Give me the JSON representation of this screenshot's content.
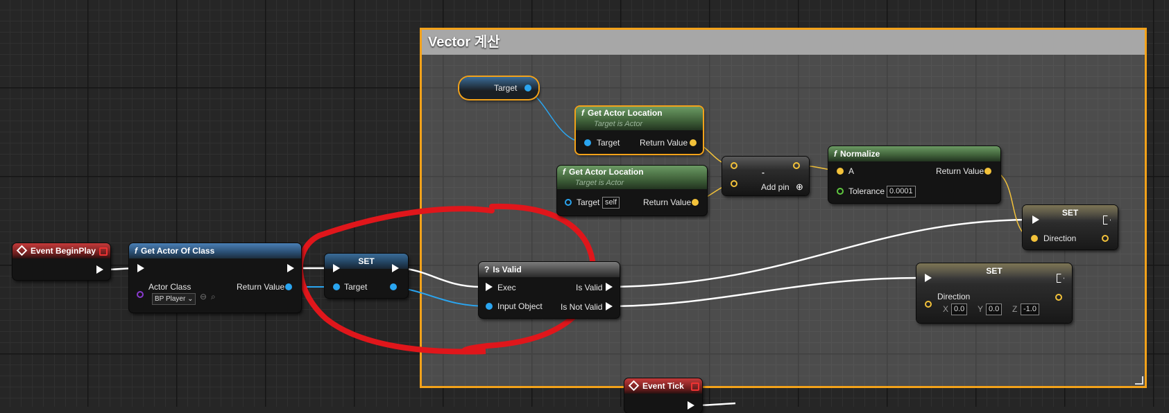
{
  "comment": {
    "title": "Vector 계산"
  },
  "event_begin_play": {
    "title": "Event BeginPlay"
  },
  "get_actor_of_class": {
    "title": "Get Actor Of Class",
    "actor_class_label": "Actor Class",
    "actor_class_value": "BP Player",
    "return_label": "Return Value"
  },
  "set_target": {
    "title": "SET",
    "target_label": "Target"
  },
  "is_valid": {
    "title": "Is Valid",
    "exec_label": "Exec",
    "input_label": "Input Object",
    "is_valid_label": "Is Valid",
    "is_not_valid_label": "Is Not Valid"
  },
  "target_var": {
    "label": "Target"
  },
  "get_actor_location_1": {
    "title": "Get Actor Location",
    "subtitle": "Target is Actor",
    "target_label": "Target",
    "return_label": "Return Value"
  },
  "get_actor_location_2": {
    "title": "Get Actor Location",
    "subtitle": "Target is Actor",
    "target_label": "Target",
    "target_value": "self",
    "return_label": "Return Value"
  },
  "subtract": {
    "symbol": "-",
    "add_pin_label": "Add pin"
  },
  "normalize": {
    "title": "Normalize",
    "a_label": "A",
    "return_label": "Return Value",
    "tolerance_label": "Tolerance",
    "tolerance_value": "0.0001"
  },
  "set_direction_1": {
    "title": "SET",
    "direction_label": "Direction"
  },
  "set_direction_2": {
    "title": "SET",
    "direction_label": "Direction",
    "x_label": "X",
    "x_value": "0.0",
    "y_label": "Y",
    "y_value": "0.0",
    "z_label": "Z",
    "z_value": "-1.0"
  },
  "event_tick": {
    "title": "Event Tick"
  },
  "colors": {
    "exec": "#ffffff",
    "object": "#2aa5f0",
    "vector": "#f3c23a",
    "float": "#60c840",
    "class": "#8a3ad0",
    "comment_border": "#f3a21a",
    "annotation": "#e0161b"
  }
}
